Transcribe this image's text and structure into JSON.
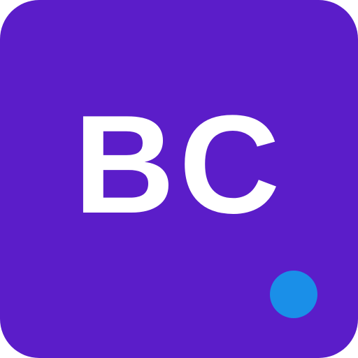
{
  "icon": {
    "label": "BC",
    "background_color": "#5b1dc9",
    "text_color": "#ffffff",
    "status_dot_color": "#1a8fe8"
  }
}
